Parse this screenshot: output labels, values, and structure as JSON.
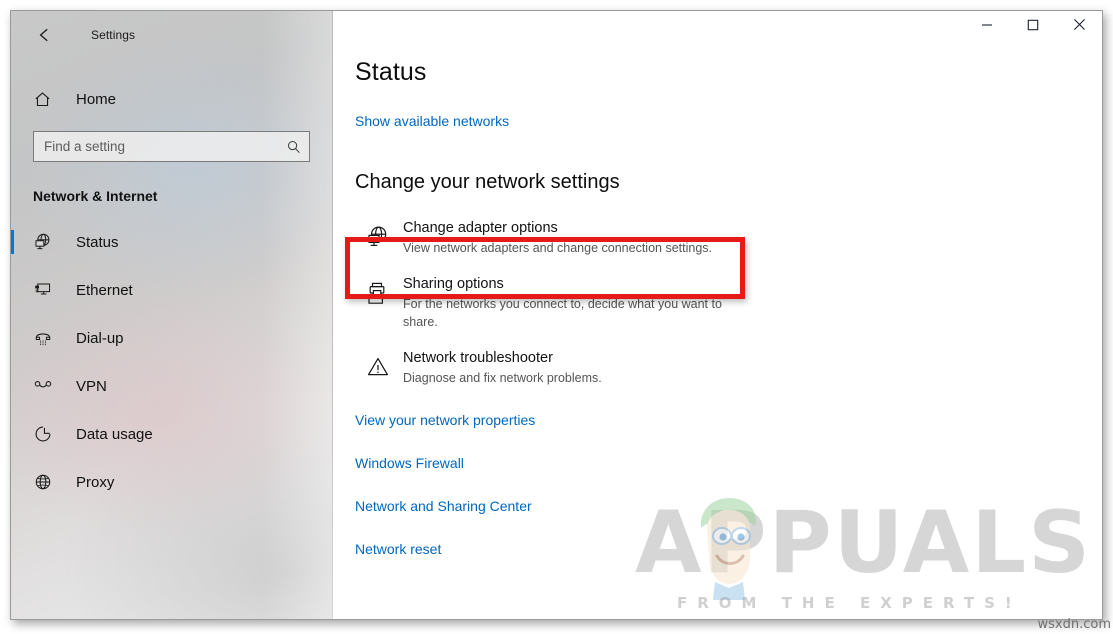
{
  "window": {
    "app_title": "Settings",
    "back_icon": "back-arrow-icon",
    "controls": {
      "minimize": "minimize-icon",
      "maximize": "maximize-icon",
      "close": "close-icon"
    }
  },
  "sidebar": {
    "home_label": "Home",
    "home_icon": "home-icon",
    "search": {
      "placeholder": "Find a setting",
      "value": "",
      "icon": "search-icon"
    },
    "category_title": "Network & Internet",
    "items": [
      {
        "label": "Status",
        "icon": "globe-monitor-icon",
        "selected": true
      },
      {
        "label": "Ethernet",
        "icon": "ethernet-icon",
        "selected": false
      },
      {
        "label": "Dial-up",
        "icon": "dialup-phone-icon",
        "selected": false
      },
      {
        "label": "VPN",
        "icon": "vpn-icon",
        "selected": false
      },
      {
        "label": "Data usage",
        "icon": "pie-chart-icon",
        "selected": false
      },
      {
        "label": "Proxy",
        "icon": "globe-icon",
        "selected": false
      }
    ]
  },
  "main": {
    "page_title": "Status",
    "show_networks_link": "Show available networks",
    "section_heading": "Change your network settings",
    "entries": [
      {
        "title": "Change adapter options",
        "desc": "View network adapters and change connection settings.",
        "icon": "globe-monitor-icon",
        "highlighted": true
      },
      {
        "title": "Sharing options",
        "desc": "For the networks you connect to, decide what you want to share.",
        "icon": "sharing-printer-folder-icon",
        "highlighted": false
      },
      {
        "title": "Network troubleshooter",
        "desc": "Diagnose and fix network problems.",
        "icon": "warning-triangle-icon",
        "highlighted": false
      }
    ],
    "links": [
      "View your network properties",
      "Windows Firewall",
      "Network and Sharing Center",
      "Network reset"
    ]
  },
  "watermark": {
    "brand": "APPUALS",
    "tagline": "FROM THE EXPERTS!",
    "corner": "wsxdn.com"
  },
  "colors": {
    "accent": "#0078d7",
    "link": "#0067c0",
    "highlight": "#e51b18"
  }
}
